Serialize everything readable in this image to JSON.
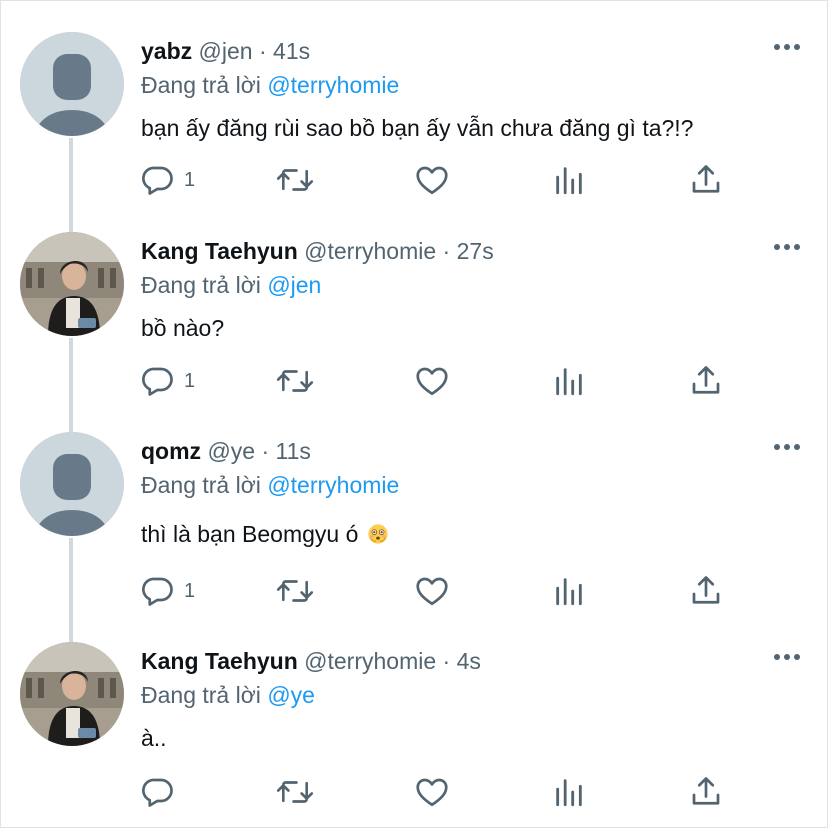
{
  "thread": {
    "reply_prefix": "Đang trả lời",
    "tweets": [
      {
        "name": "yabz",
        "handle": "@jen",
        "dot": "·",
        "time": "41s",
        "reply_to": "@terryhomie",
        "text": "bạn ấy đăng rùi sao bồ bạn ấy vẫn chưa đăng gì ta?!?",
        "reply_count": "1",
        "avatar": "default-avatar"
      },
      {
        "name": "Kang Taehyun",
        "handle": "@terryhomie",
        "dot": "·",
        "time": "27s",
        "reply_to": "@jen",
        "text": "bồ nào?",
        "reply_count": "1",
        "avatar": "photo-avatar"
      },
      {
        "name": "qomz",
        "handle": "@ye",
        "dot": "·",
        "time": "11s",
        "reply_to": "@terryhomie",
        "text": "thì là bạn Beomgyu ó",
        "emoji": "flushed-face-emoji",
        "reply_count": "1",
        "avatar": "default-avatar"
      },
      {
        "name": "Kang Taehyun",
        "handle": "@terryhomie",
        "dot": "·",
        "time": "4s",
        "reply_to": "@ye",
        "text": "à..",
        "reply_count": "",
        "avatar": "photo-avatar"
      }
    ]
  },
  "icons": {
    "reply": "reply-icon",
    "retweet": "retweet-icon",
    "like": "like-icon",
    "analytics": "analytics-icon",
    "share": "share-icon",
    "more": "more-icon"
  },
  "colors": {
    "mention": "#1d9bf0",
    "secondary_text": "#536471",
    "primary_text": "#0f1419",
    "thread_line": "#cfd9de",
    "default_avatar_bg": "#ccd6dd",
    "default_avatar_fg": "#657786"
  }
}
